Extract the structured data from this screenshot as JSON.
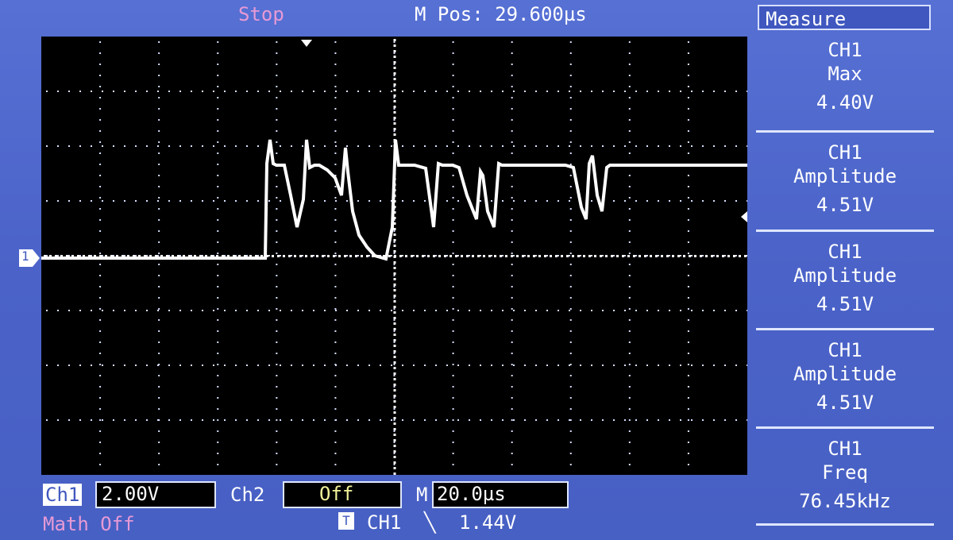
{
  "status": "Stop",
  "position": "M Pos: 29.600µs",
  "menu": {
    "title": "Measure"
  },
  "measurements": [
    {
      "channel": "CH1",
      "type": "Max",
      "value": "4.40V"
    },
    {
      "channel": "CH1",
      "type": "Amplitude",
      "value": "4.51V"
    },
    {
      "channel": "CH1",
      "type": "Amplitude",
      "value": "4.51V"
    },
    {
      "channel": "CH1",
      "type": "Amplitude",
      "value": "4.51V"
    },
    {
      "channel": "CH1",
      "type": "Freq",
      "value": "76.45kHz"
    }
  ],
  "bottom": {
    "ch1_label": "Ch1",
    "ch1_scale": "2.00V",
    "ch2_label": "Ch2",
    "ch2_state": "Off",
    "math": "Math Off",
    "timebase_label": "M",
    "timebase": "20.0µs",
    "trigger_tag": "T",
    "trigger_source": "CH1",
    "trigger_slope": "╲",
    "trigger_level": "1.44V"
  },
  "ground_marker": "1",
  "colors": {
    "screen_bg": "#4a62c6",
    "grid_bg": "#000000",
    "trace": "#ffffff",
    "stop": "#e79ad6",
    "ch2_off": "#f2f29a",
    "math": "#e79ad6"
  }
}
